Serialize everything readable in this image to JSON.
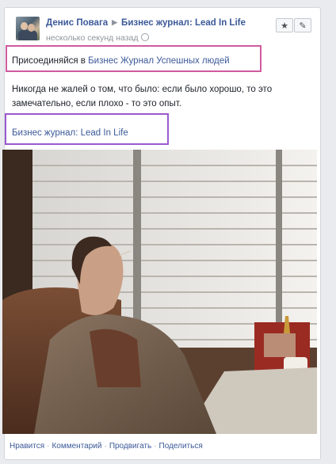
{
  "post": {
    "author": "Денис Повага",
    "target": "Бизнес журнал: Lead In Life",
    "time": "несколько секунд назад",
    "line1_prefix": "Присоединяйся в",
    "line1_link": "Бизнес Журнал Успешных людей",
    "paragraph": "Никогда не жалей о том, что было: если было хорошо, то это замечательно, если плохо - то это опыт.",
    "link_text": "Бизнес журнал: Lead In Life"
  },
  "actions": {
    "like": "Нравится",
    "comment": "Комментарий",
    "promote": "Продвигать",
    "share": "Поделиться"
  },
  "header_buttons": {
    "star_icon": "★",
    "edit_icon": "✎"
  },
  "colors": {
    "link": "#3b5998",
    "highlight_pink": "#cf5a9e",
    "highlight_purple": "#9b59d0"
  }
}
